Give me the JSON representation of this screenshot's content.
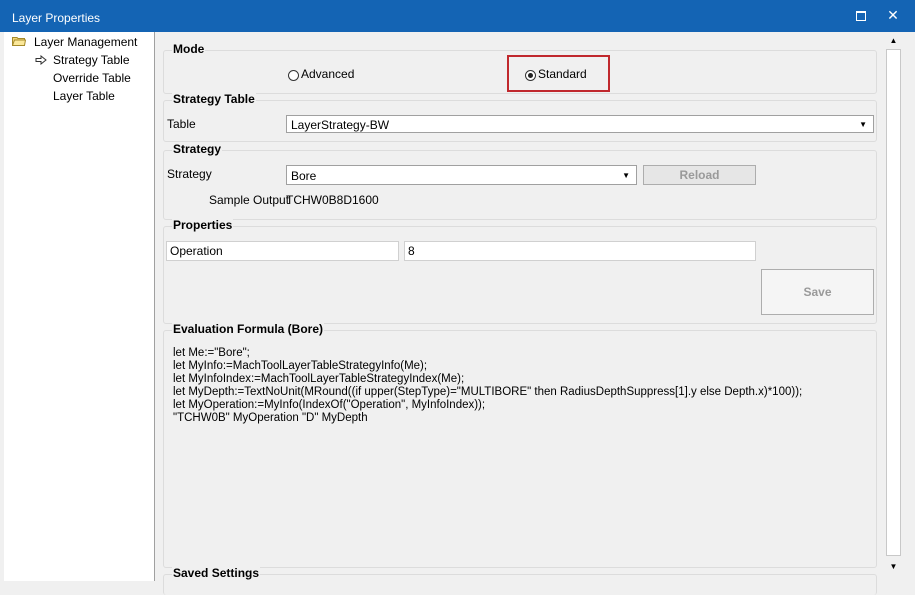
{
  "window": {
    "title": "Layer Properties",
    "maximize_icon": "maximize-icon",
    "close_icon": "close-icon",
    "close_glyph": "✕"
  },
  "tree": {
    "items": [
      {
        "label": "Layer Management",
        "icon": "folder-icon"
      },
      {
        "label": "Strategy Table",
        "icon": "arrow-icon",
        "selected": true
      },
      {
        "label": "Override Table"
      },
      {
        "label": "Layer Table"
      }
    ]
  },
  "mode": {
    "title": "Mode",
    "options": [
      {
        "label": "Advanced",
        "checked": false
      },
      {
        "label": "Standard",
        "checked": true
      }
    ],
    "highlight_color": "#c0282d"
  },
  "strategy_table": {
    "title": "Strategy Table",
    "table_label": "Table",
    "table_value": "LayerStrategy-BW"
  },
  "strategy": {
    "title": "Strategy",
    "strategy_label": "Strategy",
    "strategy_value": "Bore",
    "reload_label": "Reload",
    "sample_output_label": "Sample Output",
    "sample_output_value": "TCHW0B8D1600"
  },
  "properties": {
    "title": "Properties",
    "name": "Operation",
    "value": "8",
    "save_label": "Save"
  },
  "formula": {
    "title": "Evaluation Formula (Bore)",
    "lines": [
      "let Me:=\"Bore\";",
      "let MyInfo:=MachToolLayerTableStrategyInfo(Me);",
      "let MyInfoIndex:=MachToolLayerTableStrategyIndex(Me);",
      "let MyDepth:=TextNoUnit(MRound((if upper(StepType)=\"MULTIBORE\" then RadiusDepthSuppress[1].y else Depth.x)*100));",
      "let MyOperation:=MyInfo(IndexOf(\"Operation\", MyInfoIndex));",
      "\"TCHW0B\" MyOperation \"D\" MyDepth"
    ]
  },
  "saved_settings": {
    "title": "Saved Settings"
  },
  "scrollbar": {
    "up_glyph": "▲",
    "down_glyph": "▼"
  },
  "colors": {
    "titlebar": "#1464b4",
    "background": "#f0f0f0"
  }
}
